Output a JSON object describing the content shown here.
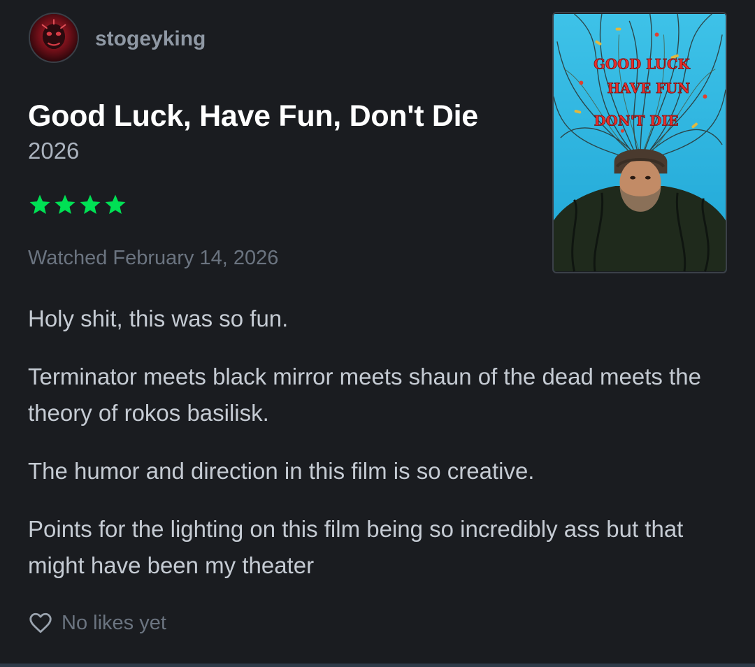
{
  "review": {
    "username": "stogeyking",
    "avatar_icon": "user-avatar-icon",
    "film_title": "Good Luck, Have Fun, Don't Die",
    "film_year": "2026",
    "rating_stars": 4,
    "rating_max": 5,
    "star_color": "#00e054",
    "watched_text": "Watched February 14, 2026",
    "poster": {
      "line1": "GOOD LUCK",
      "line2": "HAVE FUN",
      "line3": "DON'T DIE"
    },
    "paragraphs": [
      "Holy shit, this was so fun.",
      "Terminator meets black mirror meets shaun of the dead meets the theory of rokos basilisk.",
      "The humor and direction in this film is so creative.",
      "Points for the lighting on this film being so incredibly ass but that might have been my theater"
    ],
    "likes": {
      "icon": "heart-icon",
      "text": "No likes yet"
    }
  },
  "colors": {
    "background": "#1a1c20",
    "title": "#ffffff",
    "body_text": "#c5cbd3",
    "muted_text": "#6b7480",
    "username": "#8f98a4",
    "accent_green": "#00e054"
  }
}
